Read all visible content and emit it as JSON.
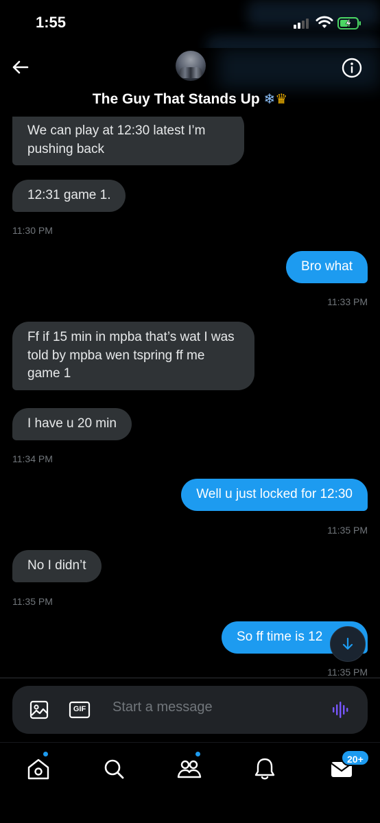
{
  "status_bar": {
    "time": "1:55"
  },
  "header": {
    "title": "The Guy That Stands Up",
    "title_emojis": "❄️👑"
  },
  "messages": [
    {
      "direction": "in",
      "text": "We can play at 12:30 latest I’m pushing back"
    },
    {
      "direction": "in",
      "text": "12:31 game 1.",
      "timestamp": "11:30 PM"
    },
    {
      "direction": "out",
      "text": "Bro what",
      "timestamp": "11:33 PM"
    },
    {
      "direction": "in",
      "text": "Ff if 15 min in mpba that’s wat I was told by mpba wen tspring ff me game 1"
    },
    {
      "direction": "in",
      "text": "I have u 20 min",
      "timestamp": "11:34 PM"
    },
    {
      "direction": "out",
      "text": "Well u just locked for 12:30",
      "timestamp": "11:35 PM"
    },
    {
      "direction": "in",
      "text": "No I didn’t",
      "timestamp": "11:35 PM"
    },
    {
      "direction": "out",
      "text": "So ff time is 12",
      "timestamp": "11:35 PM"
    }
  ],
  "composer": {
    "placeholder": "Start a message",
    "gif_label": "GIF"
  },
  "bottom_nav": {
    "items": [
      "home-icon",
      "search-icon",
      "communities-icon",
      "notifications-icon",
      "messages-icon"
    ],
    "messages_badge": "20+"
  },
  "colors": {
    "accent": "#1d9bf0",
    "incoming_bubble": "#2f3336",
    "background": "#000000",
    "voice_accent": "#7856ff"
  }
}
